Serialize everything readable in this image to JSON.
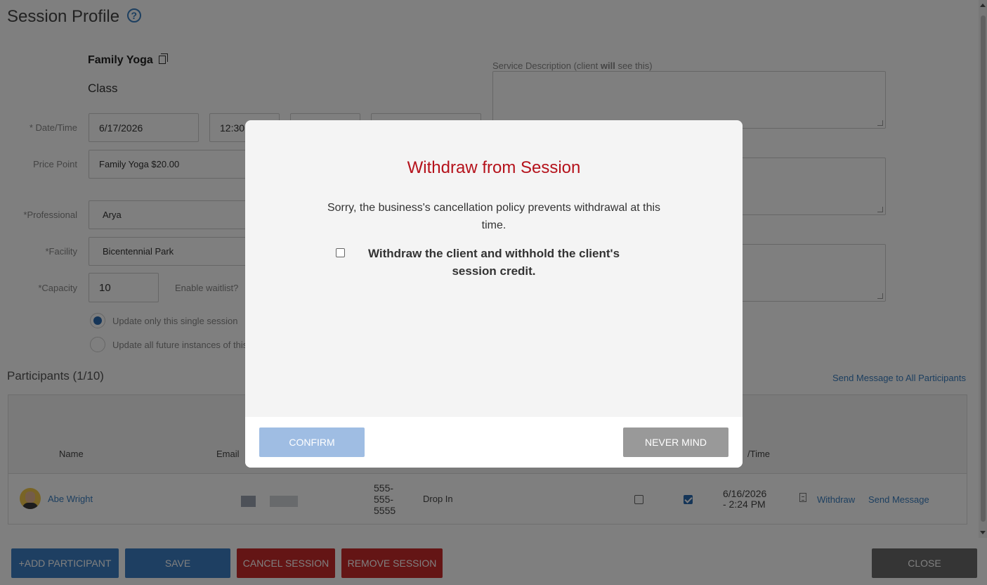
{
  "page": {
    "title": "Session Profile",
    "help_icon": "?"
  },
  "service": {
    "name": "Family Yoga",
    "type": "Class"
  },
  "form": {
    "datetime_label": "* Date/Time",
    "date_value": "6/17/2026",
    "time_value": "12:30",
    "price_label": "Price Point",
    "price_value": "Family Yoga $20.00",
    "professional_label": "*Professional",
    "professional_value": "Arya",
    "facility_label": "*Facility",
    "facility_value": "Bicentennial Park",
    "capacity_label": "*Capacity",
    "capacity_value": "10",
    "waitlist_label": "Enable waitlist?",
    "radio_single": "Update only this single session",
    "radio_all": "Update all future instances of this"
  },
  "description": {
    "label_prefix": "Service Description (client ",
    "label_bold": "will",
    "label_suffix": " see this)"
  },
  "participants": {
    "title": "Participants (1/10)",
    "send_all": "Send Message to All Participants",
    "headers": {
      "name": "Name",
      "email": "Email",
      "datetime": "/Time"
    },
    "rows": [
      {
        "name": "Abe Wright",
        "phone": "555-\n555-\n5555",
        "type": "Drop In",
        "check1": false,
        "check2": true,
        "datetime": "6/16/2026\n- 2:24 PM",
        "withdraw": "Withdraw",
        "send_message": "Send Message"
      }
    ]
  },
  "footer": {
    "add_participant": "+ADD PARTICIPANT",
    "save": "SAVE",
    "cancel_session": "CANCEL SESSION",
    "remove_session": "REMOVE SESSION",
    "close": "CLOSE"
  },
  "modal": {
    "title": "Withdraw from Session",
    "message": "Sorry, the business's cancellation policy prevents withdrawal at this time.",
    "checkbox_label": "Withdraw the client and withhold the client's session credit.",
    "checkbox_checked": false,
    "confirm": "CONFIRM",
    "never_mind": "NEVER MIND"
  },
  "colors": {
    "accent": "#3d7fc4",
    "danger": "#c82a2a",
    "modal_title": "#b5121b",
    "confirm_disabled": "#9fbde3"
  }
}
